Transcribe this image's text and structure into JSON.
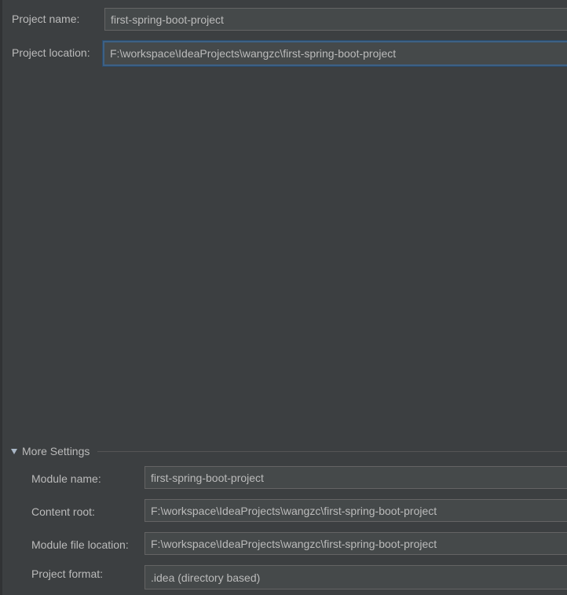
{
  "project": {
    "name_label": "Project name:",
    "name_value": "first-spring-boot-project",
    "location_label": "Project location:",
    "location_value": "F:\\workspace\\IdeaProjects\\wangzc\\first-spring-boot-project"
  },
  "more_settings": {
    "title": "More Settings",
    "expanded": true,
    "module_name_label": "Module name:",
    "module_name_value": "first-spring-boot-project",
    "content_root_label": "Content root:",
    "content_root_value": "F:\\workspace\\IdeaProjects\\wangzc\\first-spring-boot-project",
    "module_file_location_label": "Module file location:",
    "module_file_location_value": "F:\\workspace\\IdeaProjects\\wangzc\\first-spring-boot-project",
    "project_format_label": "Project format:",
    "project_format_value": ".idea (directory based)"
  },
  "theme": {
    "background": "#3c3f41",
    "field_background": "#45494a",
    "field_border": "#646464",
    "focus_border": "#3d6185",
    "text": "#bbbbbb"
  }
}
